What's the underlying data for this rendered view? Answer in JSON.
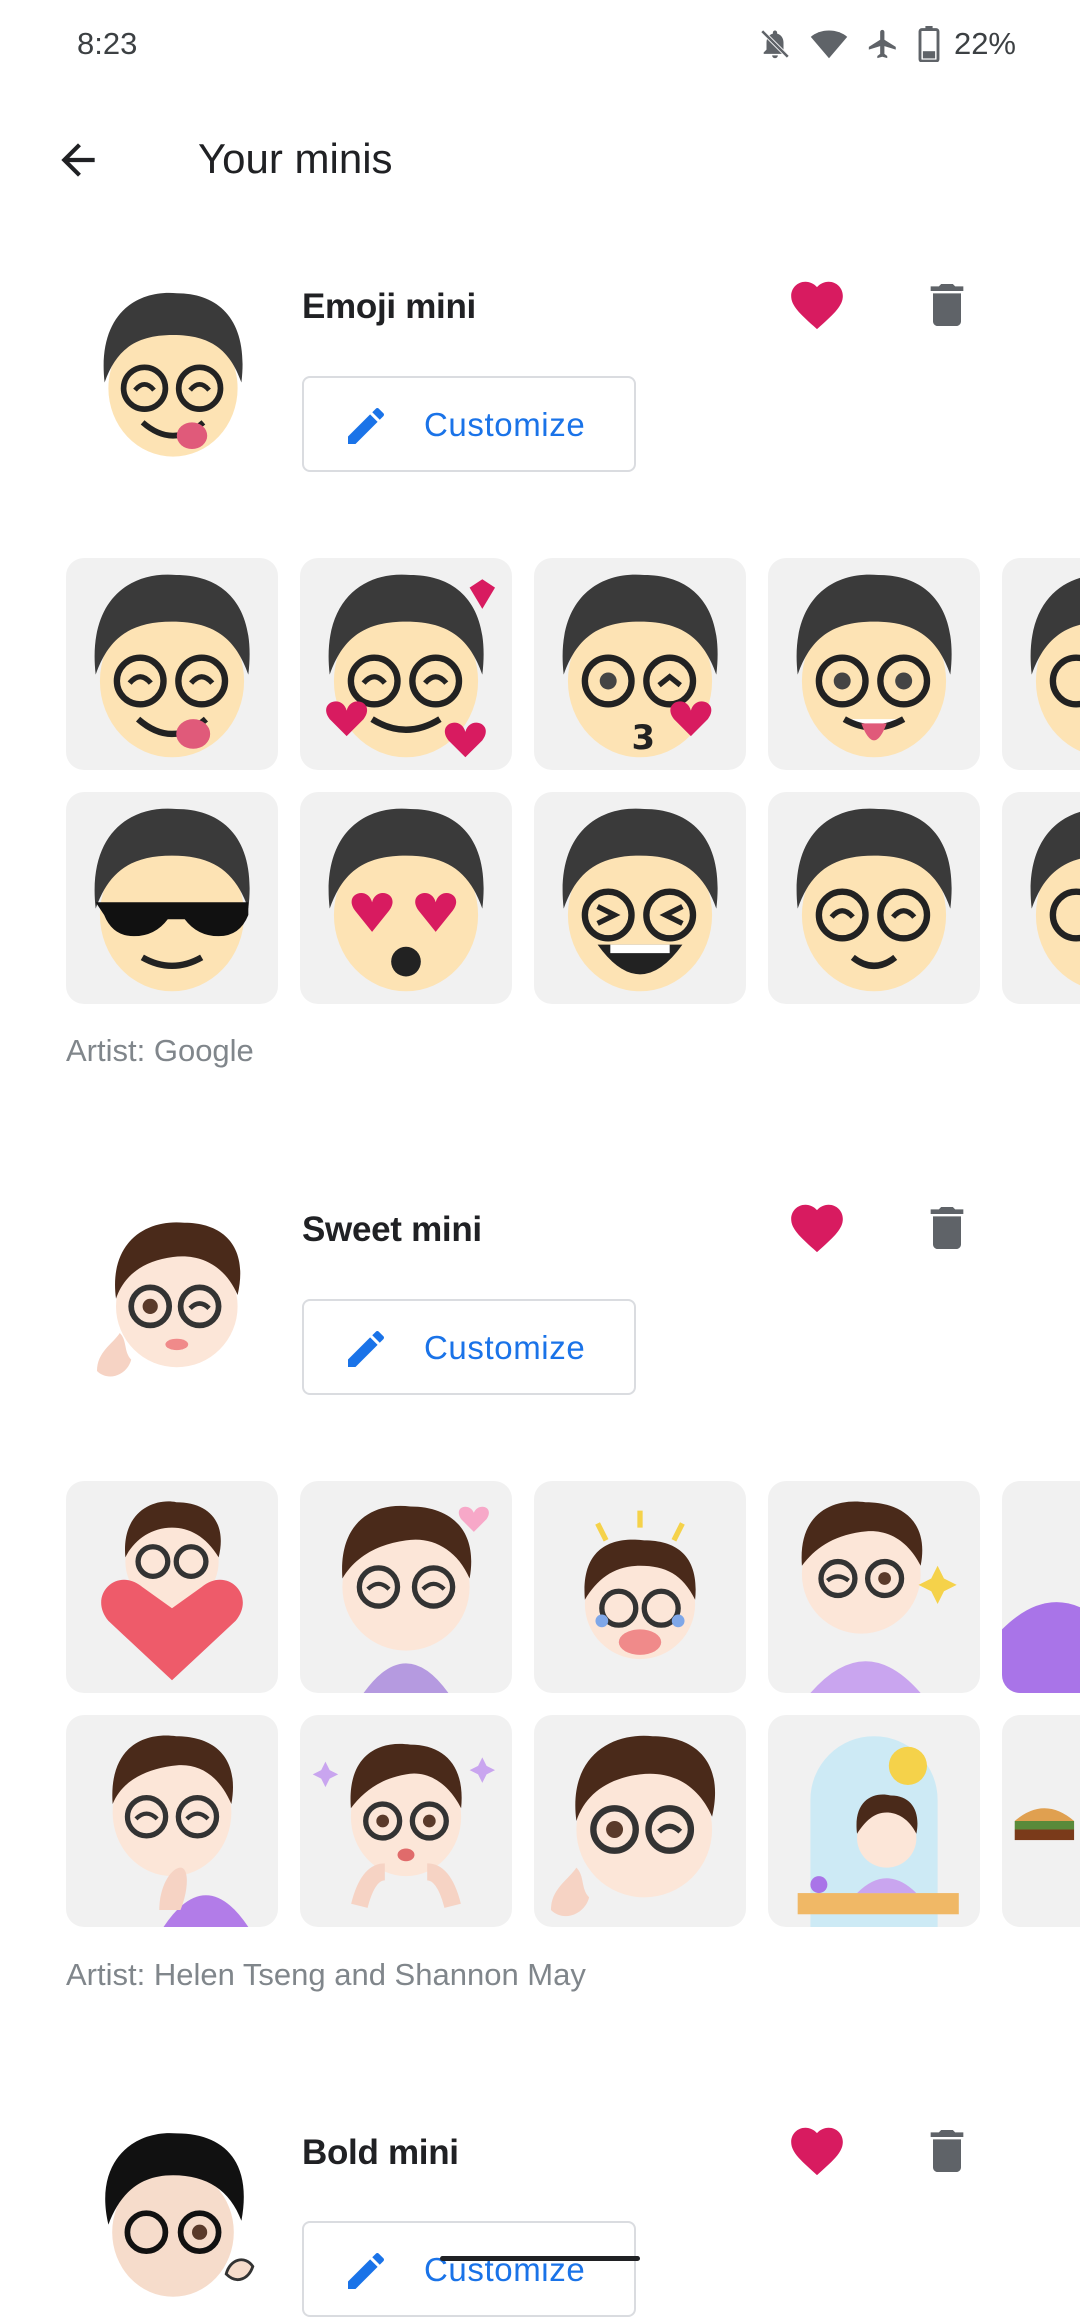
{
  "status_bar": {
    "time": "8:23",
    "battery": "22%"
  },
  "app_bar": {
    "title": "Your minis"
  },
  "sections": [
    {
      "name": "Emoji mini",
      "customize_label": "Customize",
      "artist": "Artist: Google",
      "favorite": true,
      "style": {
        "hair": "#3a3a3a",
        "skin": "#fde3b4"
      }
    },
    {
      "name": "Sweet mini",
      "customize_label": "Customize",
      "artist": "Artist: Helen Tseng and Shannon May",
      "favorite": true,
      "style": {
        "hair": "#4a2a1a",
        "skin": "#fce6d8"
      }
    },
    {
      "name": "Bold mini",
      "customize_label": "Customize",
      "favorite": true,
      "style": {
        "hair": "#111111",
        "skin": "#f6dccb"
      }
    }
  ],
  "colors": {
    "accent": "#1a73e8",
    "heart": "#d81b60",
    "trash": "#5f6368",
    "tile": "#f1f1f1"
  },
  "icons": [
    "back-arrow-icon",
    "heart-icon",
    "trash-icon",
    "pencil-icon",
    "bell-off-icon",
    "wifi-icon",
    "airplane-icon",
    "battery-icon"
  ]
}
